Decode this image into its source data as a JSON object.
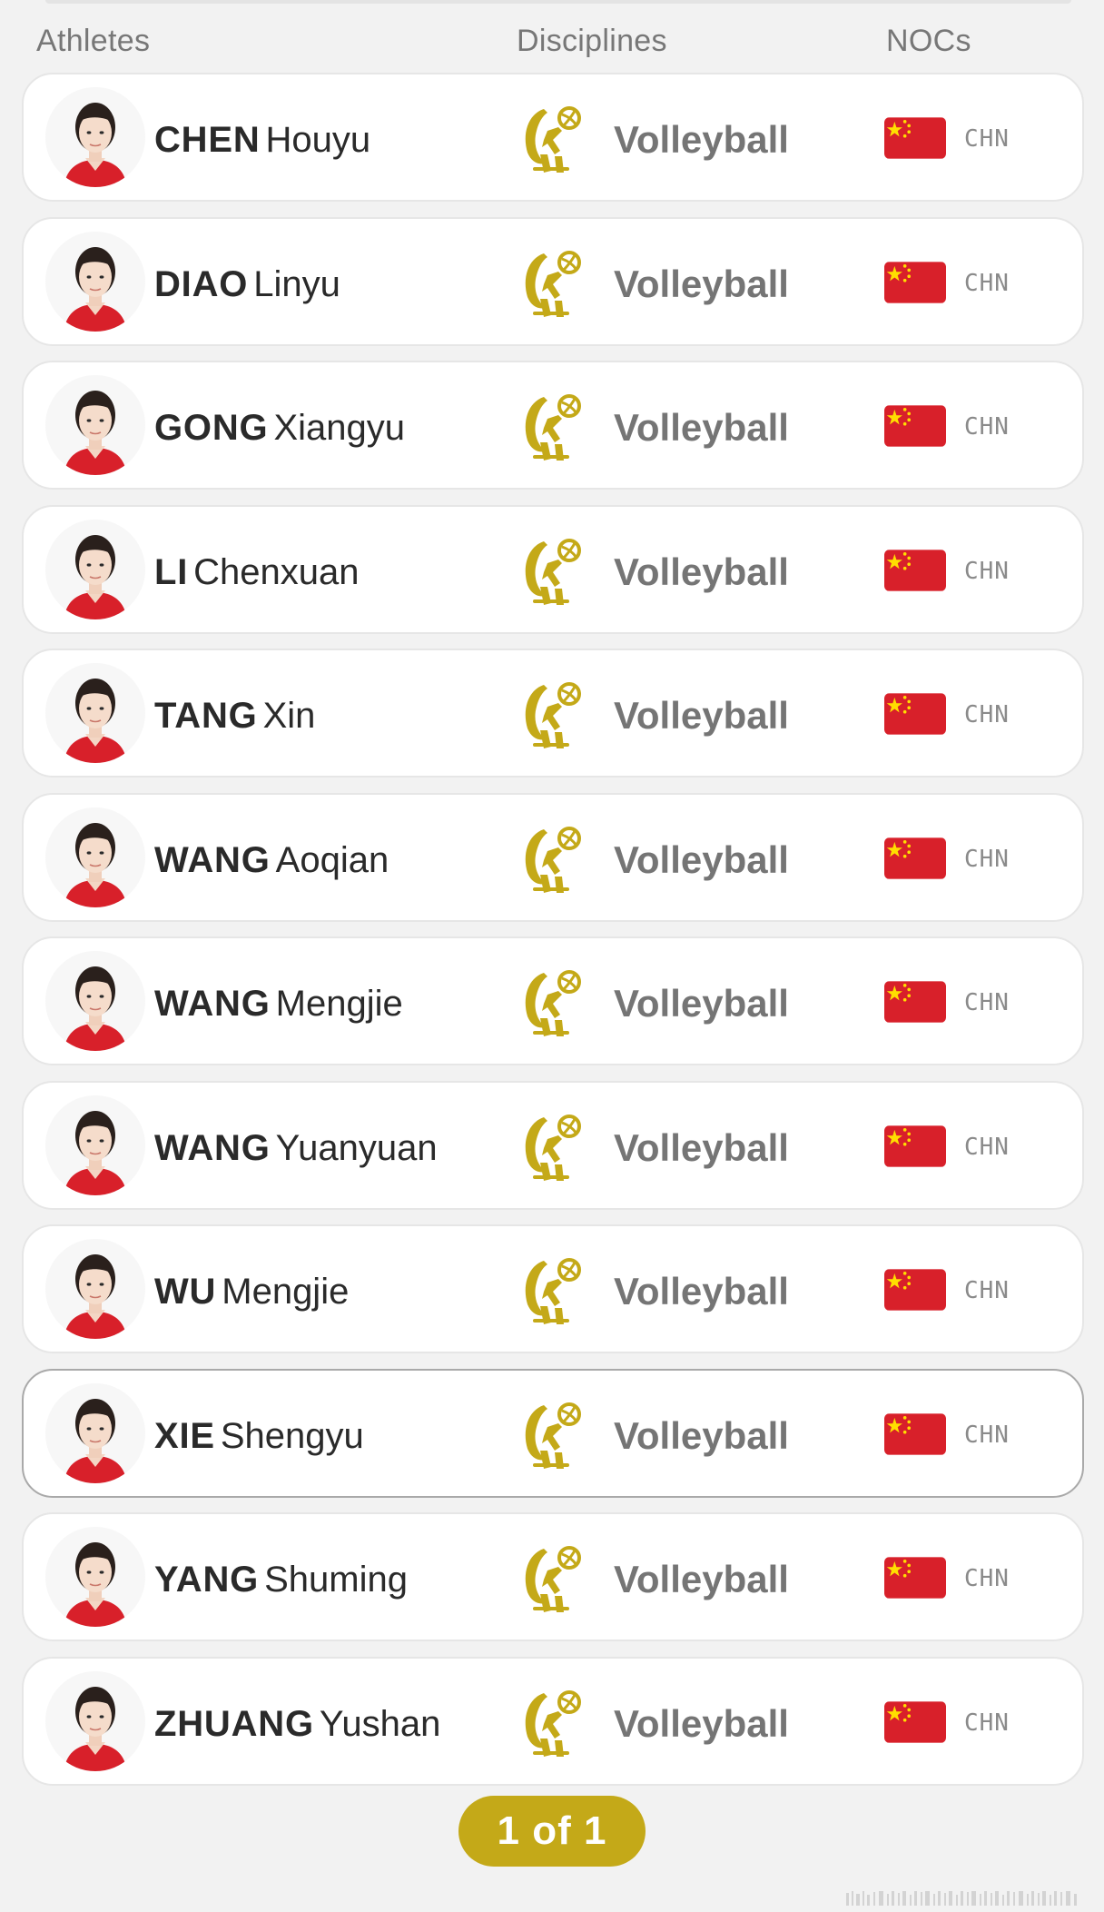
{
  "header": {
    "athletes_label": "Athletes",
    "disciplines_label": "Disciplines",
    "nocs_label": "NOCs"
  },
  "athletes": [
    {
      "surname": "CHEN",
      "given": "Houyu",
      "discipline": "Volleyball",
      "noc": "CHN"
    },
    {
      "surname": "DIAO",
      "given": "Linyu",
      "discipline": "Volleyball",
      "noc": "CHN"
    },
    {
      "surname": "GONG",
      "given": "Xiangyu",
      "discipline": "Volleyball",
      "noc": "CHN"
    },
    {
      "surname": "LI",
      "given": "Chenxuan",
      "discipline": "Volleyball",
      "noc": "CHN"
    },
    {
      "surname": "TANG",
      "given": "Xin",
      "discipline": "Volleyball",
      "noc": "CHN"
    },
    {
      "surname": "WANG",
      "given": "Aoqian",
      "discipline": "Volleyball",
      "noc": "CHN"
    },
    {
      "surname": "WANG",
      "given": "Mengjie",
      "discipline": "Volleyball",
      "noc": "CHN"
    },
    {
      "surname": "WANG",
      "given": "Yuanyuan",
      "discipline": "Volleyball",
      "noc": "CHN"
    },
    {
      "surname": "WU",
      "given": "Mengjie",
      "discipline": "Volleyball",
      "noc": "CHN"
    },
    {
      "surname": "XIE",
      "given": "Shengyu",
      "discipline": "Volleyball",
      "noc": "CHN"
    },
    {
      "surname": "YANG",
      "given": "Shuming",
      "discipline": "Volleyball",
      "noc": "CHN"
    },
    {
      "surname": "ZHUANG",
      "given": "Yushan",
      "discipline": "Volleyball",
      "noc": "CHN"
    }
  ],
  "pagination": {
    "label": "1 of 1"
  },
  "icons": {
    "discipline": "volleyball-pictogram-icon",
    "flag": "china-flag-icon",
    "avatar": "athlete-portrait"
  },
  "colors": {
    "accent_gold": "#c4a918",
    "flag_red": "#d8202a",
    "flag_star": "#ffde00",
    "jersey_red": "#d8202a"
  }
}
